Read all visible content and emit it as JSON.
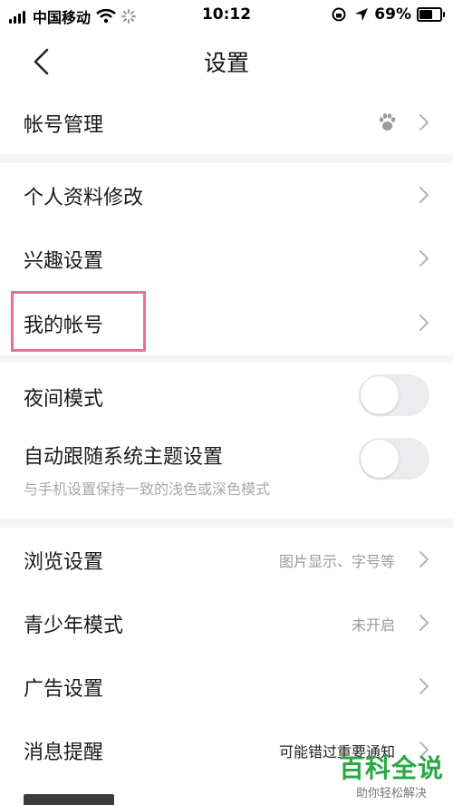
{
  "status_bar": {
    "carrier": "中国移动",
    "time": "10:12",
    "battery": "69%"
  },
  "nav": {
    "title": "设置"
  },
  "groups": {
    "account": {
      "manage_label": "帐号管理"
    },
    "profile": {
      "edit_label": "个人资料修改",
      "interest_label": "兴趣设置",
      "my_account_label": "我的帐号"
    },
    "display": {
      "night_label": "夜间模式",
      "night_on": false,
      "theme_label": "自动跟随系统主题设置",
      "theme_sub": "与手机设置保持一致的浅色或深色模式",
      "theme_on": false
    },
    "general": {
      "browse_label": "浏览设置",
      "browse_value": "图片显示、字号等",
      "youth_label": "青少年模式",
      "youth_value": "未开启",
      "ad_label": "广告设置",
      "notify_label": "消息提醒",
      "notify_value": "可能错过重要通知"
    }
  },
  "watermark": {
    "title": "百科全说",
    "subtitle": "助你轻松解决"
  },
  "icons": {
    "back": "chevron-left-icon",
    "chevron": "chevron-right-icon",
    "baidu": "paw-icon"
  },
  "colors": {
    "highlight": "#ee6d95",
    "watermark": "#2aa845"
  }
}
